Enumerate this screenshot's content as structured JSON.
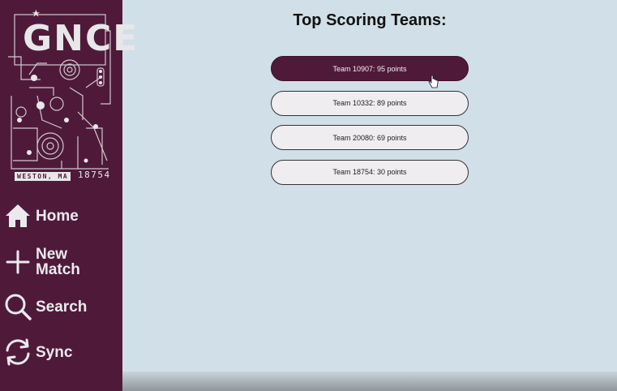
{
  "sidebar": {
    "logo": {
      "wordmark": "GNCE",
      "city": "WESTON, MA",
      "team_number": "18754"
    },
    "items": [
      {
        "label": "Home",
        "icon": "home-icon"
      },
      {
        "label": "New Match",
        "icon": "plus-icon"
      },
      {
        "label": "Search",
        "icon": "search-icon"
      },
      {
        "label": "Sync",
        "icon": "sync-icon"
      }
    ]
  },
  "main": {
    "title": "Top Scoring Teams:",
    "teams": [
      {
        "label": "Team 10907: 95 points",
        "active": true
      },
      {
        "label": "Team 10332: 89 points",
        "active": false
      },
      {
        "label": "Team 20080: 69 points",
        "active": false
      },
      {
        "label": "Team 18754: 30 points",
        "active": false
      }
    ]
  },
  "colors": {
    "sidebar": "#4f1a3a",
    "background": "#d1dfe8",
    "button": "#efedf0",
    "button_active": "#4f1a3a"
  }
}
